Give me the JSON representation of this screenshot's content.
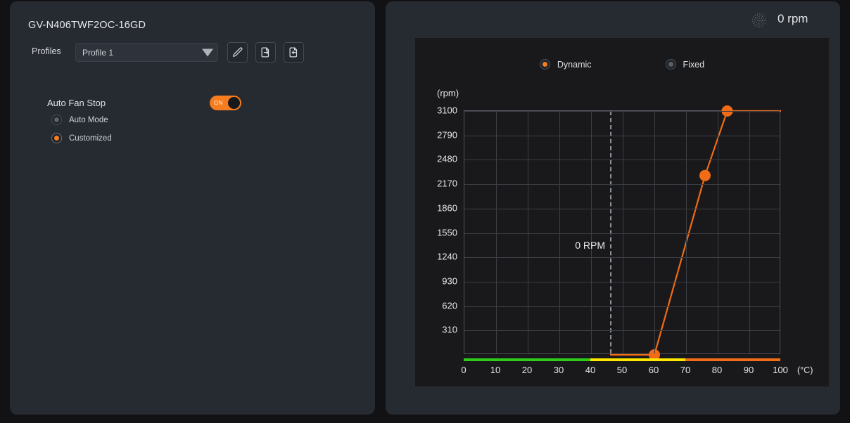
{
  "left_panel": {
    "device_title": "GV-N406TWF2OC-16GD",
    "profiles_label": "Profiles",
    "profile_selected": "Profile 1",
    "buttons": [
      {
        "name": "edit-profile-button",
        "icon": "pencil-icon"
      },
      {
        "name": "export-profile-button",
        "icon": "file-export-icon"
      },
      {
        "name": "import-profile-button",
        "icon": "file-import-icon"
      }
    ],
    "auto_fan_stop": {
      "label": "Auto Fan Stop",
      "toggle_state": "ON",
      "toggle_on": true
    },
    "modes": [
      {
        "label": "Auto Mode",
        "selected": false
      },
      {
        "label": "Customized",
        "selected": true
      }
    ]
  },
  "right_panel": {
    "fan_icon": "fan-spinning-icon",
    "rpm_readout": "0 rpm",
    "legend": [
      {
        "label": "Dynamic",
        "selected": true
      },
      {
        "label": "Fixed",
        "selected": false
      }
    ],
    "annotation": "0 RPM"
  },
  "colors": {
    "accent": "#f57c1f",
    "panel_bg": "#262a31",
    "chart_bg": "#19191c",
    "page_bg": "#121214",
    "grid": "#3b3e44",
    "text": "#e3e5e8",
    "temp_low": "#2ecc19",
    "temp_mid": "#ffe800",
    "temp_high": "#f26b16",
    "dashed": "#8d9096"
  },
  "chart_data": {
    "type": "line",
    "title": "",
    "xlabel": "(°C)",
    "ylabel": "(rpm)",
    "xlim": [
      0,
      100
    ],
    "ylim": [
      0,
      3100
    ],
    "grid": true,
    "legend_position": "top-center",
    "x_ticks": [
      0,
      10,
      20,
      30,
      40,
      50,
      60,
      70,
      80,
      90,
      100
    ],
    "y_ticks": [
      310,
      620,
      930,
      1240,
      1550,
      1860,
      2170,
      2480,
      2790,
      3100
    ],
    "series": [
      {
        "name": "Dynamic",
        "color": "#f26b16",
        "points": [
          {
            "x": 46,
            "y": 0,
            "marker": false
          },
          {
            "x": 60,
            "y": 0,
            "marker": true
          },
          {
            "x": 76,
            "y": 2280,
            "marker": true
          },
          {
            "x": 83,
            "y": 3100,
            "marker": true
          },
          {
            "x": 100,
            "y": 3100,
            "marker": false
          }
        ]
      }
    ],
    "annotations": [
      {
        "text": "0 RPM",
        "x": 46,
        "y": 1380,
        "align": "right"
      }
    ],
    "vertical_marker": {
      "x": 46,
      "style": "dashed",
      "color": "#8d9096"
    },
    "temperature_bar": [
      {
        "from": 0,
        "to": 40,
        "color": "#2ecc19"
      },
      {
        "from": 40,
        "to": 70,
        "color": "#ffe800"
      },
      {
        "from": 70,
        "to": 100,
        "color": "#f26b16"
      }
    ]
  }
}
